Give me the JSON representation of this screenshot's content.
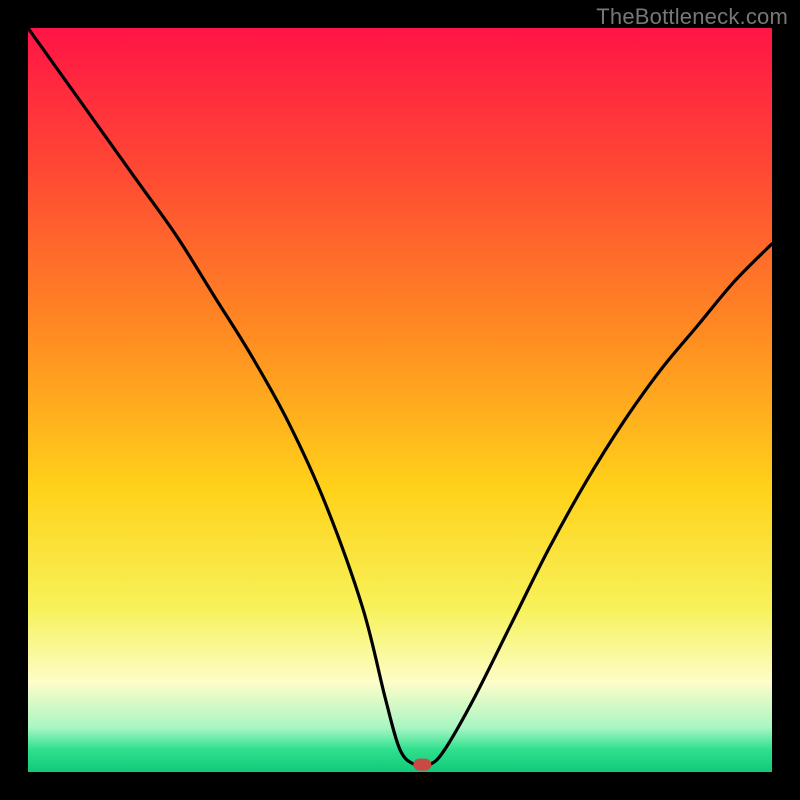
{
  "watermark": "TheBottleneck.com",
  "chart_data": {
    "type": "line",
    "title": "",
    "xlabel": "",
    "ylabel": "",
    "xlim": [
      0,
      100
    ],
    "ylim": [
      0,
      100
    ],
    "grid": false,
    "legend": false,
    "background_gradient": {
      "stops": [
        {
          "offset": 0.0,
          "color": "#ff1446"
        },
        {
          "offset": 0.2,
          "color": "#ff4b33"
        },
        {
          "offset": 0.42,
          "color": "#ff8e21"
        },
        {
          "offset": 0.62,
          "color": "#ffd21a"
        },
        {
          "offset": 0.78,
          "color": "#f7f25a"
        },
        {
          "offset": 0.88,
          "color": "#fdfdc8"
        },
        {
          "offset": 0.94,
          "color": "#a9f6c4"
        },
        {
          "offset": 0.97,
          "color": "#2fe08e"
        },
        {
          "offset": 1.0,
          "color": "#10c979"
        }
      ]
    },
    "series": [
      {
        "name": "bottleneck_curve",
        "x": [
          0,
          5,
          10,
          15,
          20,
          25,
          30,
          35,
          40,
          45,
          48,
          50,
          52,
          54,
          56,
          60,
          65,
          70,
          75,
          80,
          85,
          90,
          95,
          100
        ],
        "y": [
          100,
          93,
          86,
          79,
          72,
          64,
          56,
          47,
          36,
          22,
          10,
          3,
          1,
          1,
          3,
          10,
          20,
          30,
          39,
          47,
          54,
          60,
          66,
          71
        ]
      }
    ],
    "marker": {
      "x": 53,
      "y": 1,
      "color": "#c94a44"
    }
  }
}
